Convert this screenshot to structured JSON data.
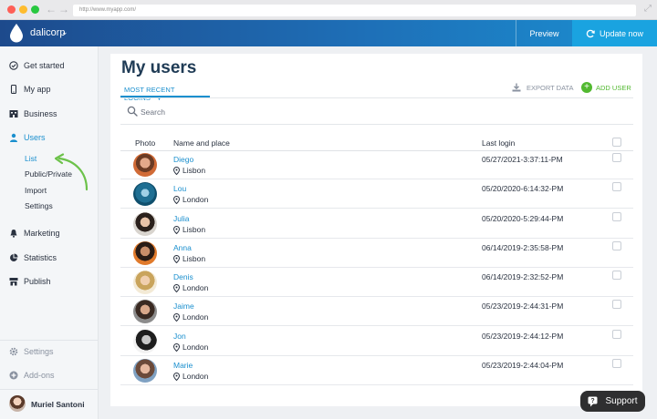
{
  "browser": {
    "url": "http://www.myapp.com/"
  },
  "topbar": {
    "brand": "dalicorp",
    "preview": "Preview",
    "update": "Update now"
  },
  "sidebar": {
    "items": [
      {
        "label": "Get started",
        "icon": "check-circle-icon"
      },
      {
        "label": "My app",
        "icon": "mobile-icon"
      },
      {
        "label": "Business",
        "icon": "building-icon"
      },
      {
        "label": "Users",
        "icon": "user-icon"
      },
      {
        "label": "Marketing",
        "icon": "bell-icon"
      },
      {
        "label": "Statistics",
        "icon": "pie-chart-icon"
      },
      {
        "label": "Publish",
        "icon": "store-icon"
      }
    ],
    "subitems": [
      "List",
      "Public/Private",
      "Import",
      "Settings"
    ],
    "footer": [
      {
        "label": "Settings",
        "icon": "gear-icon"
      },
      {
        "label": "Add-ons",
        "icon": "plus-circle-icon"
      }
    ],
    "user": "Muriel Santoni"
  },
  "main": {
    "title": "My users",
    "tab": "MOST RECENT LOGINS",
    "export": "EXPORT DATA",
    "add_user": "ADD USER",
    "search_placeholder": "Search",
    "columns": {
      "photo": "Photo",
      "name": "Name and place",
      "login": "Last login"
    },
    "rows": [
      {
        "name": "Diego",
        "place": "Lisbon",
        "login": "05/27/2021-3:37:11-PM"
      },
      {
        "name": "Lou",
        "place": "London",
        "login": "05/20/2020-6:14:32-PM"
      },
      {
        "name": "Julia",
        "place": "Lisbon",
        "login": "05/20/2020-5:29:44-PM"
      },
      {
        "name": "Anna",
        "place": "Lisbon",
        "login": "06/14/2019-2:35:58-PM"
      },
      {
        "name": "Denis",
        "place": "London",
        "login": "06/14/2019-2:32:52-PM"
      },
      {
        "name": "Jaime",
        "place": "London",
        "login": "05/23/2019-2:44:31-PM"
      },
      {
        "name": "Jon",
        "place": "London",
        "login": "05/23/2019-2:44:12-PM"
      },
      {
        "name": "Marie",
        "place": "London",
        "login": "05/23/2019-2:44:04-PM"
      }
    ]
  },
  "support": {
    "label": "Support"
  },
  "colors": {
    "accent": "#1a8fce",
    "add_green": "#52b930",
    "title": "#1f3b55"
  }
}
